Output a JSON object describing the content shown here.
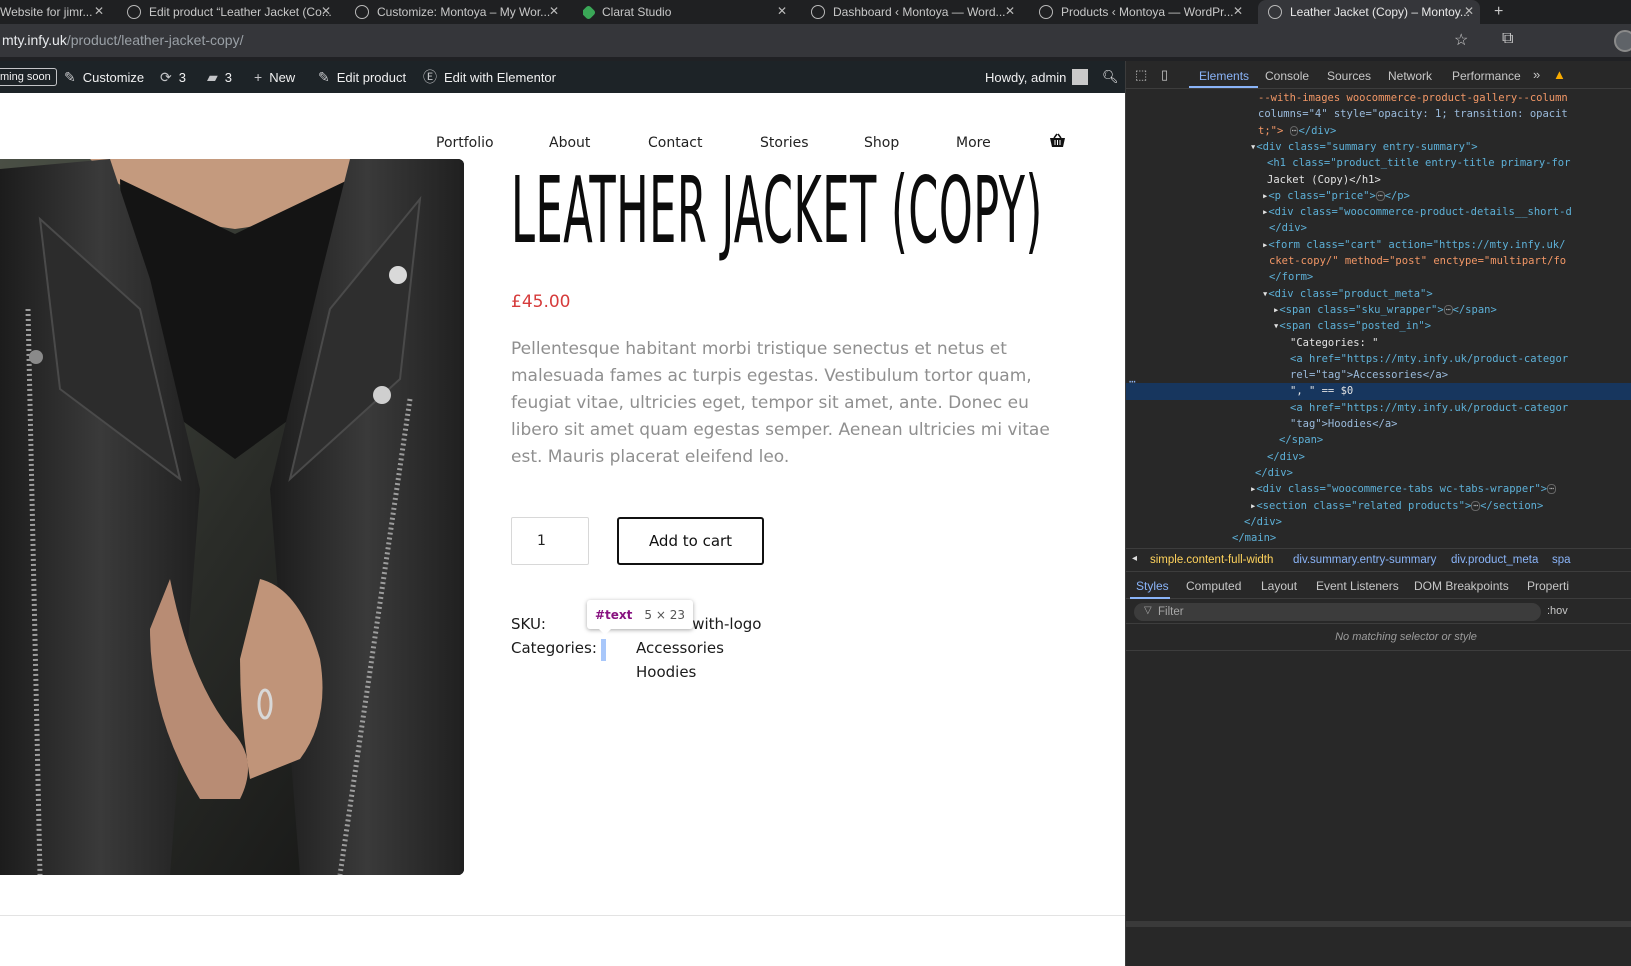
{
  "browser": {
    "tabs": [
      {
        "title": "Website for jimr...",
        "icon": "page-icon",
        "active": false
      },
      {
        "title": "Edit product “Leather Jacket (Co...",
        "icon": "wordpress-icon",
        "active": false
      },
      {
        "title": "Customize: Montoya – My Wor...",
        "icon": "wordpress-icon",
        "active": false
      },
      {
        "title": "Clarat Studio",
        "icon": "green-diamond-icon",
        "active": false
      },
      {
        "title": "Dashboard ‹ Montoya — Word...",
        "icon": "wordpress-icon",
        "active": false
      },
      {
        "title": "Products ‹ Montoya — WordPr...",
        "icon": "wordpress-icon",
        "active": false
      },
      {
        "title": "Leather Jacket (Copy) – Montoy...",
        "icon": "wordpress-icon",
        "active": true
      }
    ],
    "url_domain": "mty.infy.uk",
    "url_path": "/product/leather-jacket-copy/"
  },
  "adminbar": {
    "coming_soon": "ming soon",
    "customize": "Customize",
    "updates_count": "3",
    "comments_count": "3",
    "new": "New",
    "edit_product": "Edit product",
    "edit_elementor": "Edit with Elementor",
    "howdy": "Howdy, admin"
  },
  "nav": {
    "items": [
      "Portfolio",
      "About",
      "Contact",
      "Stories",
      "Shop",
      "More"
    ]
  },
  "product": {
    "title": "LEATHER JACKET (COPY)",
    "price": "£45.00",
    "description": "Pellentesque habitant morbi tristique senectus et netus et malesuada fames ac turpis egestas. Vestibulum tortor quam, feugiat vitae, ultricies eget, tempor sit amet, ante. Donec eu libero sit amet quam egestas semper. Aenean ultricies mi vitae est. Mauris placerat eleifend leo.",
    "quantity": "1",
    "add_to_cart": "Add to cart",
    "sku_label": "SKU:",
    "sku_value": "hoodie-with-logo",
    "categories_label": "Categories:",
    "categories": [
      "Accessories",
      "Hoodies"
    ]
  },
  "inspector_tooltip": {
    "node": "#text",
    "size": "5 × 23"
  },
  "devtools": {
    "tabs": [
      "Elements",
      "Console",
      "Sources",
      "Network",
      "Performance"
    ],
    "active_tab": "Elements",
    "breadcrumbs": [
      "simple.content-full-width",
      "div.summary.entry-summary",
      "div.product_meta",
      "spa"
    ],
    "subtabs": [
      "Styles",
      "Computed",
      "Layout",
      "Event Listeners",
      "DOM Breakpoints",
      "Properti"
    ],
    "filter_placeholder": "Filter",
    "hov": ":hov",
    "no_match": "No matching selector or style",
    "dom_lines": [
      "--with-images woocommerce-product-gallery--column",
      "columns=\"4\" style=\"opacity: 1; transition: opacit",
      "t;\">",
      "<div class=\"summary entry-summary\">",
      "<h1 class=\"product_title entry-title primary-for",
      "Jacket (Copy)</h1>",
      "<p class=\"price\">",
      "<div class=\"woocommerce-product-details__short-d",
      "</div>",
      "<form class=\"cart\" action=\"https://mty.infy.uk/",
      "cket-copy/\" method=\"post\" enctype=\"multipart/fo",
      "</form>",
      "<div class=\"product_meta\">",
      "<span class=\"sku_wrapper\">",
      "<span class=\"posted_in\">",
      "\"Categories: \"",
      "<a href=\"https://mty.infy.uk/product-categor",
      "rel=\"tag\">Accessories</a>",
      "\", \" == $0",
      "<a href=\"https://mty.infy.uk/product-categor",
      "\"tag\">Hoodies</a>",
      "</span>",
      "</div>",
      "</div>",
      "<div class=\"woocommerce-tabs wc-tabs-wrapper\">",
      "<section class=\"related products\">",
      "</div>",
      "</main>"
    ]
  },
  "colors": {
    "price": "#d63b3b",
    "devtools_accent": "#8ab4f8",
    "selection": "#17365e"
  }
}
